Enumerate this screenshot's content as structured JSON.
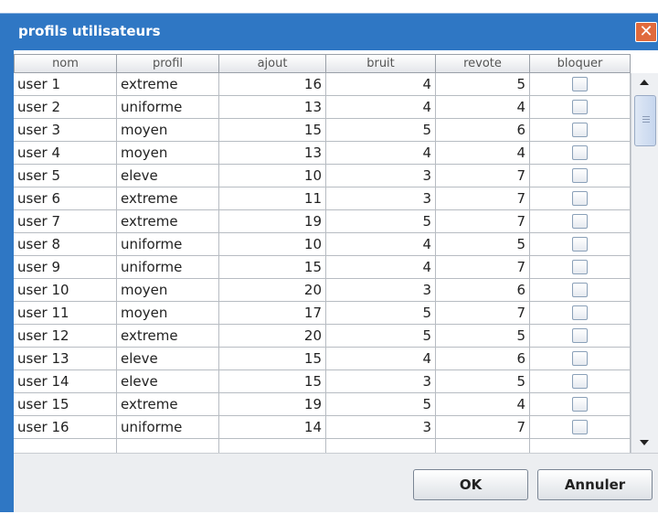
{
  "window": {
    "title": "profils utilisateurs",
    "close_symbol": "✕"
  },
  "table": {
    "columns": [
      "nom",
      "profil",
      "ajout",
      "bruit",
      "revote",
      "bloquer"
    ],
    "rows": [
      {
        "nom": "user 1",
        "profil": "extreme",
        "ajout": "16",
        "bruit": "4",
        "revote": "5",
        "bloquer": false
      },
      {
        "nom": "user 2",
        "profil": "uniforme",
        "ajout": "13",
        "bruit": "4",
        "revote": "4",
        "bloquer": false
      },
      {
        "nom": "user 3",
        "profil": "moyen",
        "ajout": "15",
        "bruit": "5",
        "revote": "6",
        "bloquer": false
      },
      {
        "nom": "user 4",
        "profil": "moyen",
        "ajout": "13",
        "bruit": "4",
        "revote": "4",
        "bloquer": false
      },
      {
        "nom": "user 5",
        "profil": "eleve",
        "ajout": "10",
        "bruit": "3",
        "revote": "7",
        "bloquer": false
      },
      {
        "nom": "user 6",
        "profil": "extreme",
        "ajout": "11",
        "bruit": "3",
        "revote": "7",
        "bloquer": false
      },
      {
        "nom": "user 7",
        "profil": "extreme",
        "ajout": "19",
        "bruit": "5",
        "revote": "7",
        "bloquer": false
      },
      {
        "nom": "user 8",
        "profil": "uniforme",
        "ajout": "10",
        "bruit": "4",
        "revote": "5",
        "bloquer": false
      },
      {
        "nom": "user 9",
        "profil": "uniforme",
        "ajout": "15",
        "bruit": "4",
        "revote": "7",
        "bloquer": false
      },
      {
        "nom": "user 10",
        "profil": "moyen",
        "ajout": "20",
        "bruit": "3",
        "revote": "6",
        "bloquer": false
      },
      {
        "nom": "user 11",
        "profil": "moyen",
        "ajout": "17",
        "bruit": "5",
        "revote": "7",
        "bloquer": false
      },
      {
        "nom": "user 12",
        "profil": "extreme",
        "ajout": "20",
        "bruit": "5",
        "revote": "5",
        "bloquer": false
      },
      {
        "nom": "user 13",
        "profil": "eleve",
        "ajout": "15",
        "bruit": "4",
        "revote": "6",
        "bloquer": false
      },
      {
        "nom": "user 14",
        "profil": "eleve",
        "ajout": "15",
        "bruit": "3",
        "revote": "5",
        "bloquer": false
      },
      {
        "nom": "user 15",
        "profil": "extreme",
        "ajout": "19",
        "bruit": "5",
        "revote": "4",
        "bloquer": false
      },
      {
        "nom": "user 16",
        "profil": "uniforme",
        "ajout": "14",
        "bruit": "3",
        "revote": "7",
        "bloquer": false
      }
    ]
  },
  "buttons": {
    "ok": "OK",
    "cancel": "Annuler"
  },
  "colors": {
    "titlebar": "#2f77c4",
    "close": "#e06a3c"
  }
}
